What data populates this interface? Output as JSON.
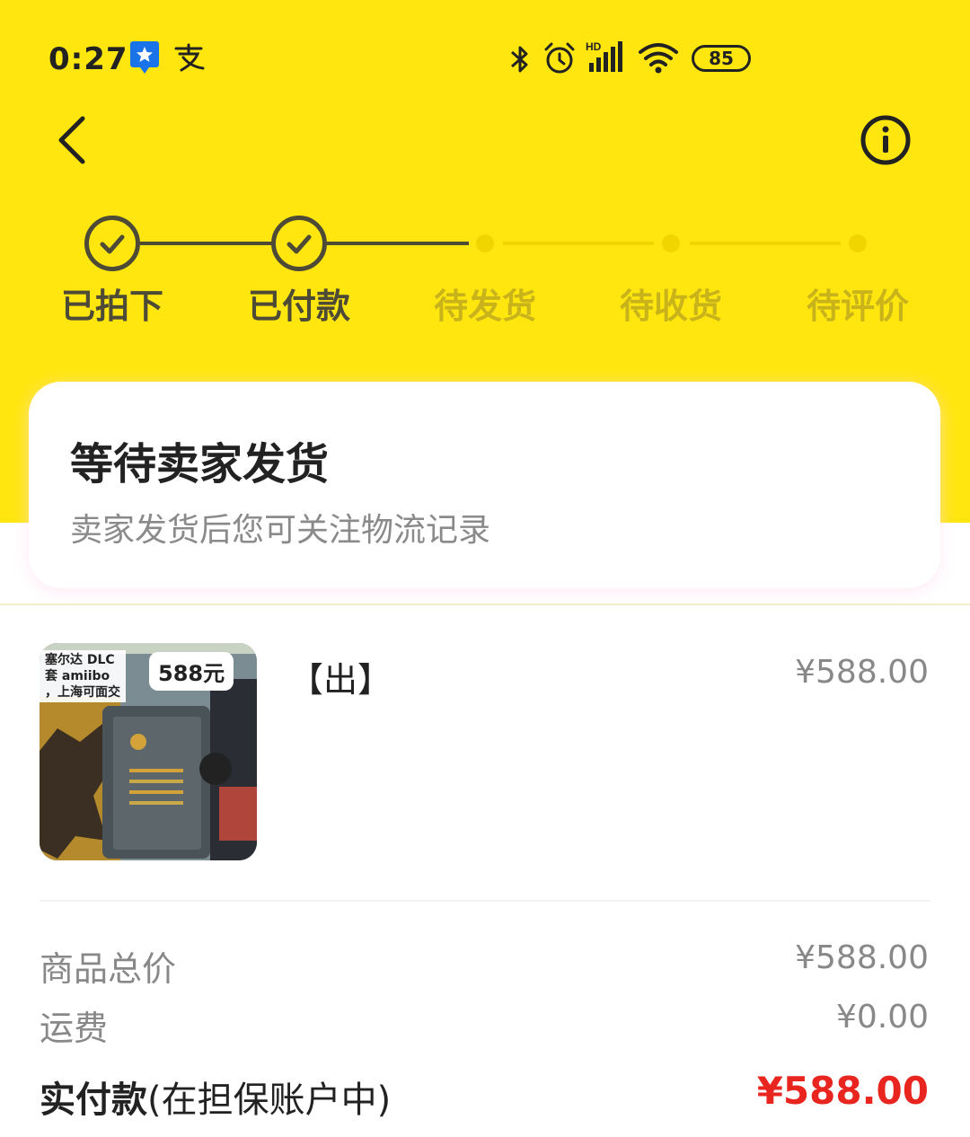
{
  "status_bar": {
    "time": "0:27",
    "battery": "85",
    "icons": [
      "app-notification-icon",
      "alipay-icon",
      "bluetooth-icon",
      "alarm-icon",
      "hd-signal-icon",
      "wifi-icon",
      "battery-icon"
    ],
    "hd_label": "HD"
  },
  "nav": {
    "back_icon": "chevron-left-icon",
    "info_icon": "info-circle-icon"
  },
  "progress": {
    "steps": [
      {
        "label": "已拍下",
        "state": "done"
      },
      {
        "label": "已付款",
        "state": "done"
      },
      {
        "label": "待发货",
        "state": "pending"
      },
      {
        "label": "待收货",
        "state": "pending"
      },
      {
        "label": "待评价",
        "state": "pending"
      }
    ]
  },
  "status_card": {
    "title": "等待卖家发货",
    "subtitle": "卖家发货后您可关注物流记录"
  },
  "item": {
    "title": "【出】",
    "price": "¥588.00",
    "thumbnail": {
      "overlay_lines": [
        "塞尔达 DLC",
        "套 amiibo",
        "，上海可面交"
      ],
      "price_tag": "588元"
    }
  },
  "summary": {
    "rows": [
      {
        "label": "商品总价",
        "value": "¥588.00"
      },
      {
        "label": "运费",
        "value": "¥0.00"
      }
    ],
    "total_label_bold": "实付款",
    "total_label_note": "(在担保账户中)",
    "total_value": "¥588.00"
  },
  "colors": {
    "brand_yellow": "#FFE60F",
    "done_text": "#4d4a36",
    "pending_text": "#c9b31a",
    "price_red": "#e8261f"
  }
}
